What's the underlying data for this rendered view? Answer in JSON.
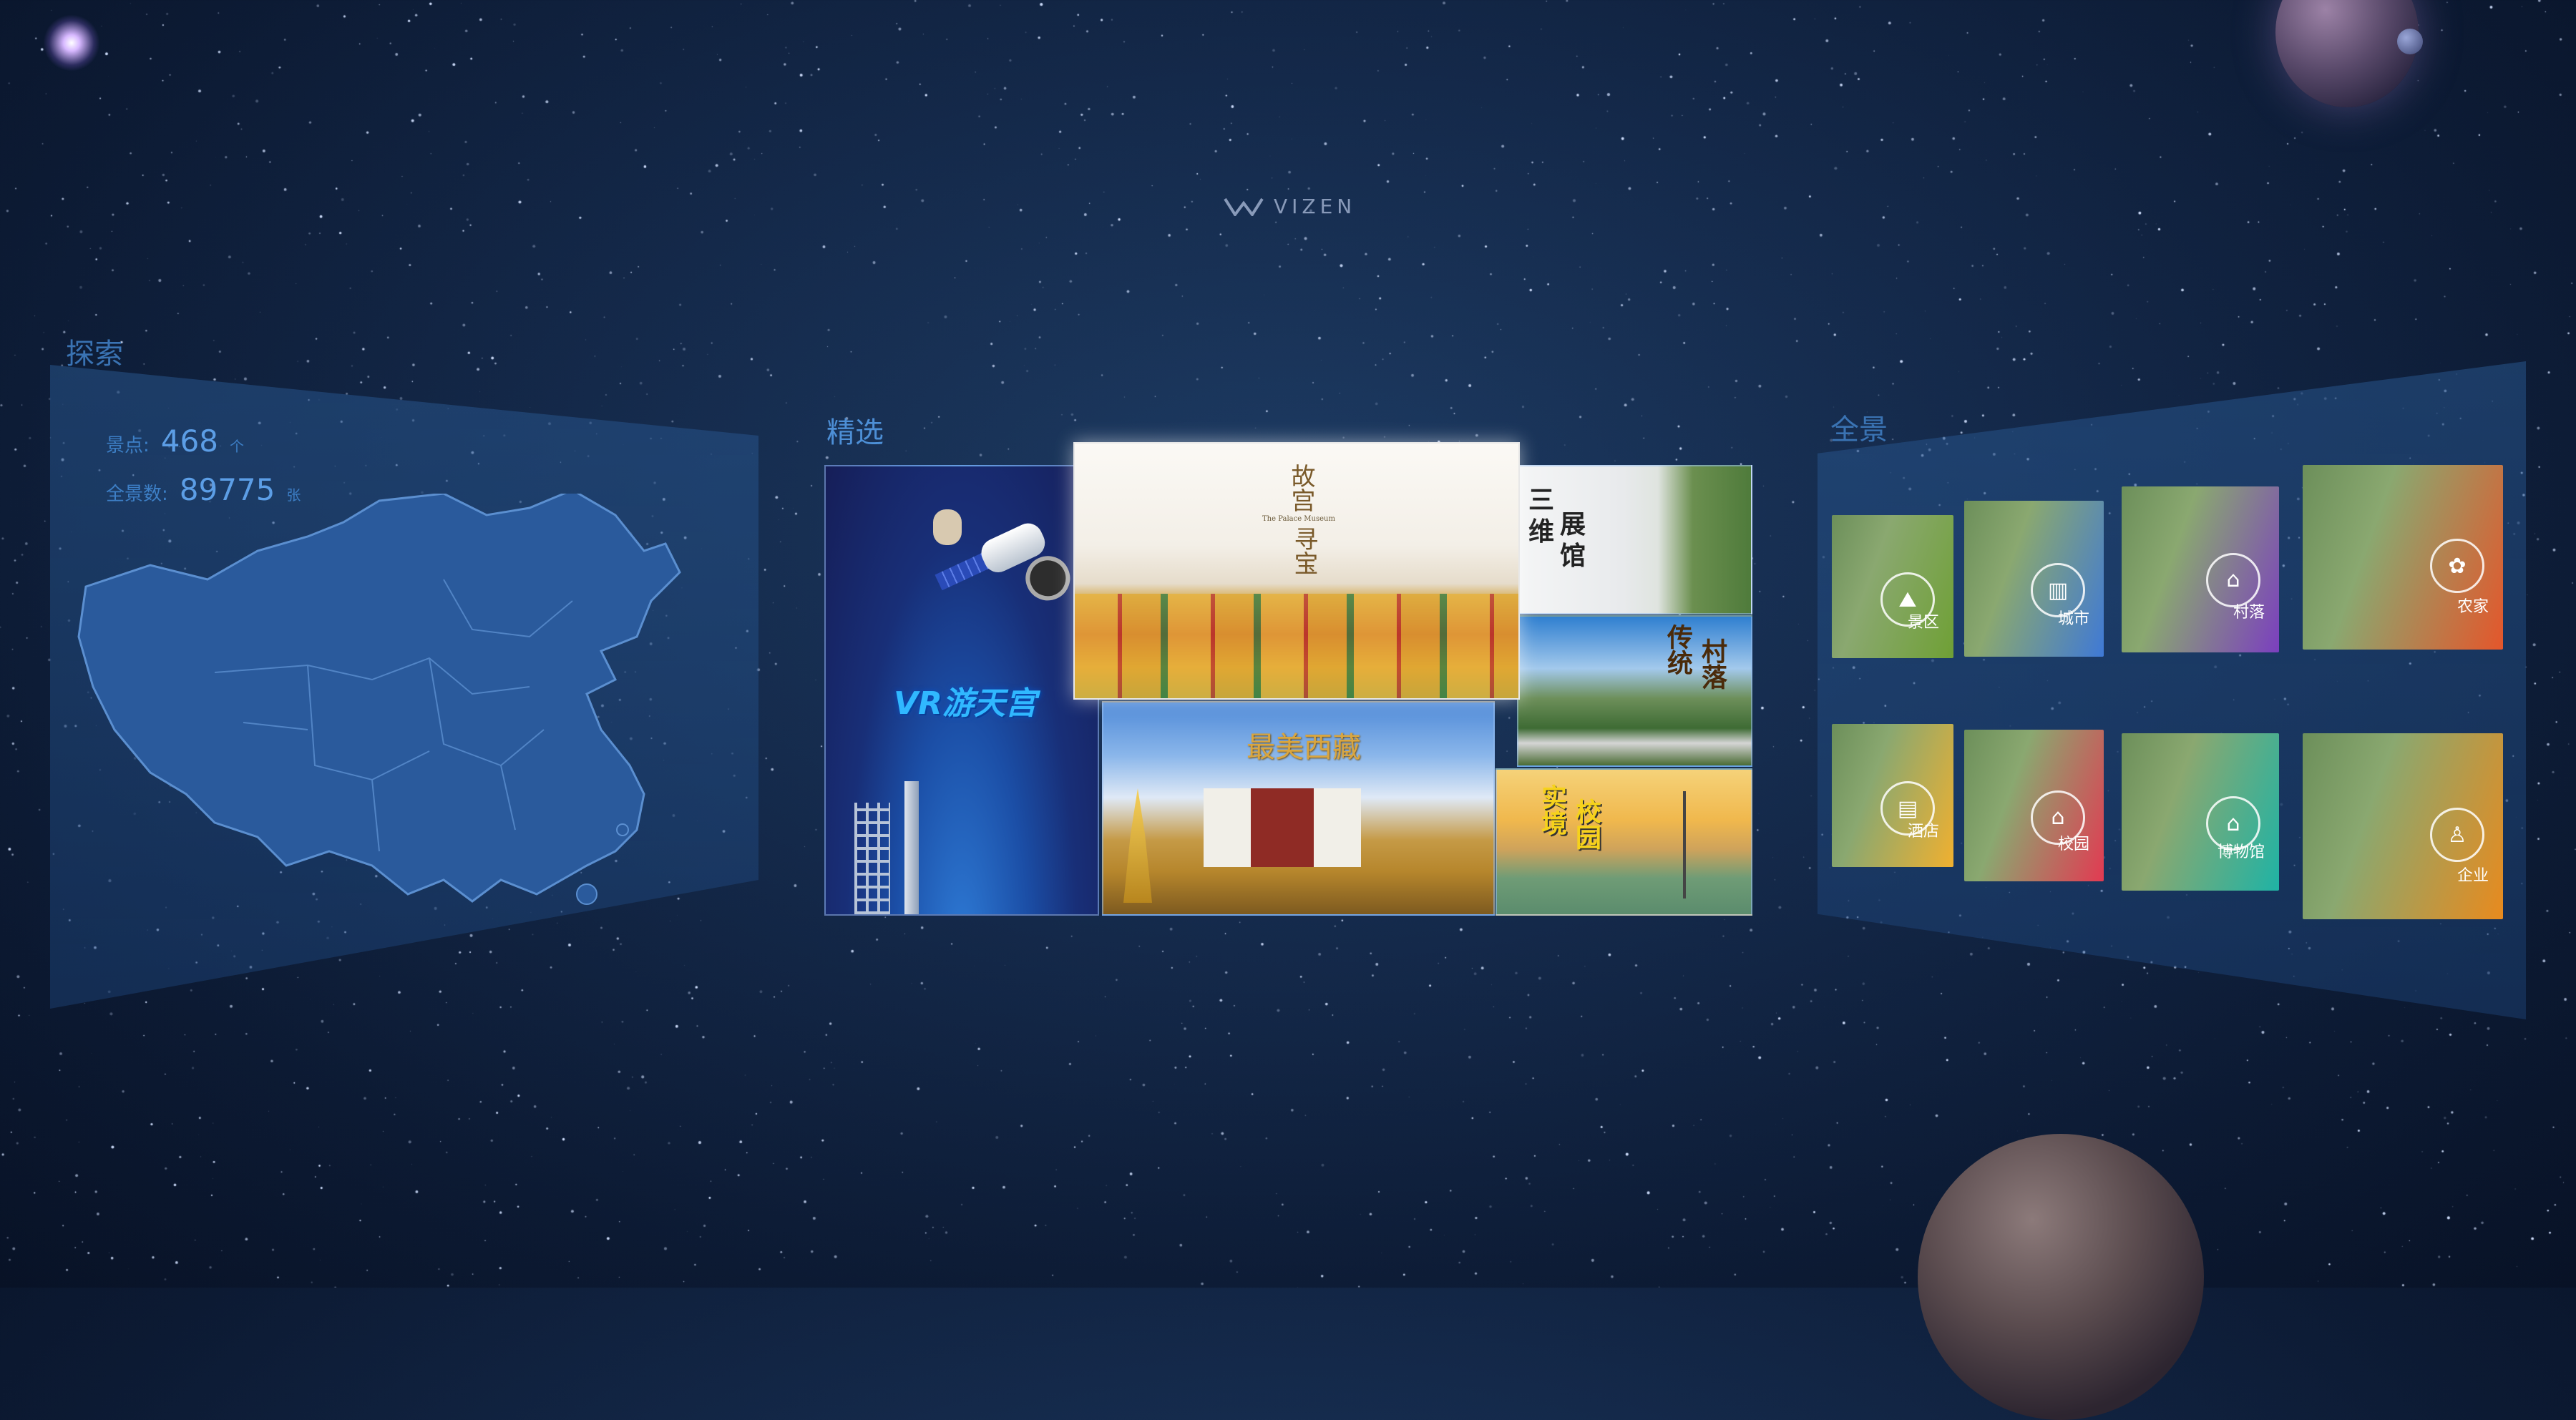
{
  "logo": {
    "text": "VIZEN"
  },
  "sections": {
    "explore": "探索",
    "featured": "精选",
    "panorama": "全景"
  },
  "stats": {
    "spots_label": "景点:",
    "spots_value": "468",
    "spots_unit": "个",
    "panoramas_label": "全景数:",
    "panoramas_value": "89775",
    "panoramas_unit": "张"
  },
  "featured_tiles": {
    "vr_space": "VR游天宫",
    "forbidden_city_line1": "故宫",
    "forbidden_city_line2": "寻宝",
    "forbidden_city_en": "The Palace Museum",
    "tibet": "最美西藏",
    "expo_line1": "三",
    "expo_line2": "维",
    "expo_line3": "展",
    "expo_line4": "馆",
    "village_line1": "传统",
    "village_line2": "村落",
    "campus_line1": "实境",
    "campus_line2": "校园"
  },
  "categories": [
    {
      "label": "景区",
      "icon": "landscape-icon",
      "glyph": "⛰",
      "color": "#6fa035"
    },
    {
      "label": "城市",
      "icon": "city-icon",
      "glyph": "▥",
      "color": "#3f79d6"
    },
    {
      "label": "村落",
      "icon": "village-icon",
      "glyph": "⌂",
      "color": "#7b3fbf"
    },
    {
      "label": "农家",
      "icon": "farm-icon",
      "glyph": "✿",
      "color": "#e4562b"
    },
    {
      "label": "酒店",
      "icon": "hotel-icon",
      "glyph": "▤",
      "color": "#f0b030"
    },
    {
      "label": "校园",
      "icon": "campus-icon",
      "glyph": "⌂",
      "color": "#e23a52"
    },
    {
      "label": "博物馆",
      "icon": "museum-icon",
      "glyph": "⌂",
      "color": "#1fb3a5"
    },
    {
      "label": "企业",
      "icon": "enterprise-icon",
      "glyph": "♙",
      "color": "#e88a1e"
    }
  ]
}
